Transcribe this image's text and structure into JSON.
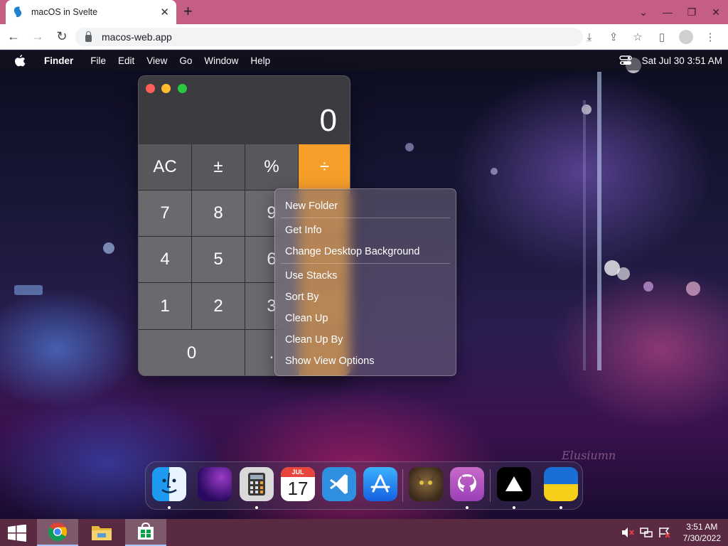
{
  "browser": {
    "tab_title": "macOS in Svelte",
    "url": "macos-web.app"
  },
  "menubar": {
    "app_name": "Finder",
    "items": [
      "File",
      "Edit",
      "View",
      "Go",
      "Window",
      "Help"
    ],
    "datetime": "Sat Jul 30  3:51 AM"
  },
  "calculator": {
    "display": "0",
    "keys": [
      "AC",
      "±",
      "%",
      "÷",
      "7",
      "8",
      "9",
      "",
      "4",
      "5",
      "6",
      "",
      "1",
      "2",
      "3",
      "",
      "0",
      ".",
      ""
    ]
  },
  "context_menu": {
    "group1": [
      "New Folder"
    ],
    "group2": [
      "Get Info",
      "Change Desktop Background"
    ],
    "group3": [
      "Use Stacks",
      "Sort By",
      "Clean Up",
      "Clean Up By",
      "Show View Options"
    ]
  },
  "dock": {
    "calendar_month": "JUL",
    "calendar_day": "17",
    "apps": [
      "finder-icon",
      "wallpapers-icon",
      "calculator-icon",
      "calendar-icon",
      "vscode-icon",
      "app-store-icon",
      "cat-photo-icon",
      "github-icon",
      "vercel-icon",
      "ukraine-flag-icon"
    ]
  },
  "watermark": "Elusiumn",
  "taskbar": {
    "time": "3:51 AM",
    "date": "7/30/2022"
  },
  "colors": {
    "calculator_operator": "#f59e2a",
    "browser_tabbar": "#c55e84",
    "taskbar": "#5a2a42"
  }
}
